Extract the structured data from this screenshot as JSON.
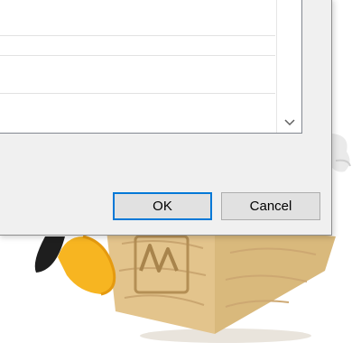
{
  "dialog": {
    "list_rows": [
      "",
      "",
      ""
    ],
    "scroll_down_icon": "chevron-down-icon",
    "ok_label": "OK",
    "cancel_label": "Cancel",
    "accent": "#0078d7"
  },
  "background": {
    "mascot": "penguin-in-wooden-crate"
  }
}
